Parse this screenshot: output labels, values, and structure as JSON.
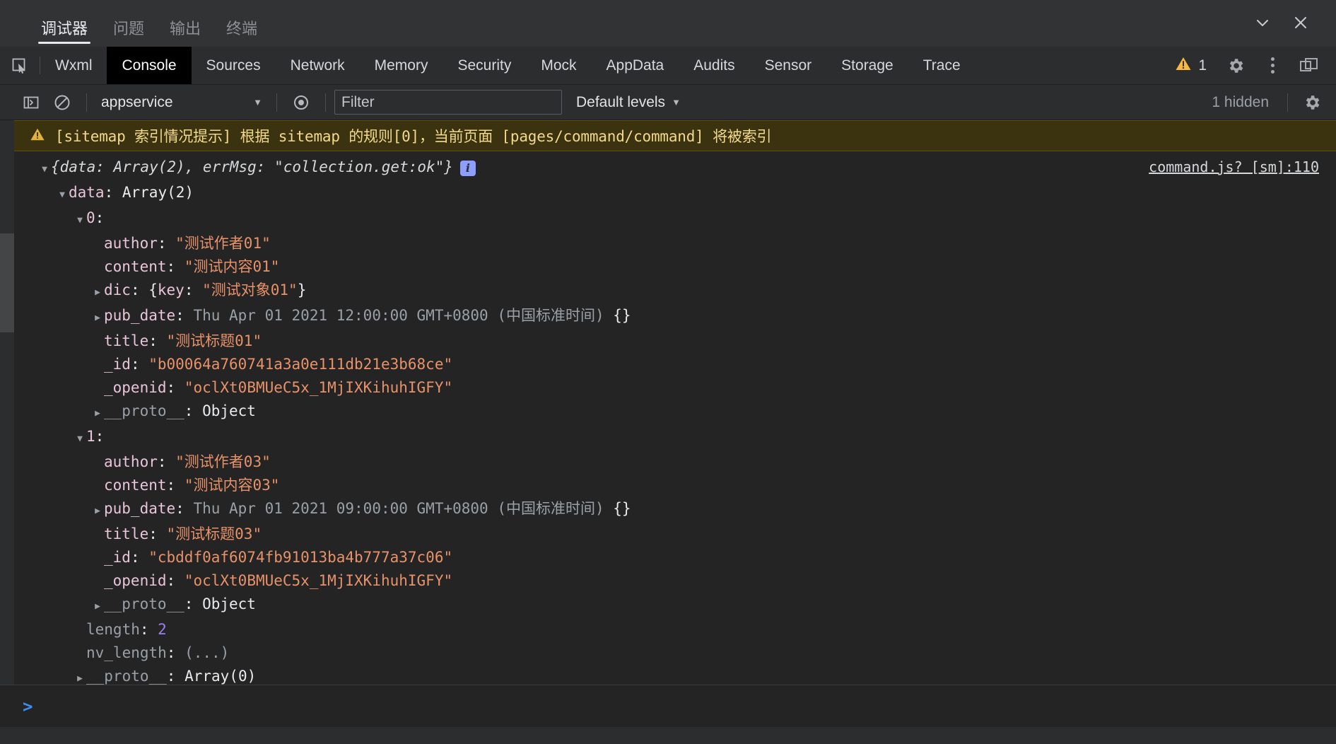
{
  "window": {
    "tabs": [
      {
        "label": "调试器",
        "active": true
      },
      {
        "label": "问题",
        "active": false
      },
      {
        "label": "输出",
        "active": false
      },
      {
        "label": "终端",
        "active": false
      }
    ],
    "minimize_icon": "chevron-down-icon",
    "close_icon": "close-icon"
  },
  "devtools": {
    "inspect_icon": "inspect-element-icon",
    "tabs": [
      {
        "label": "Wxml",
        "active": false
      },
      {
        "label": "Console",
        "active": true
      },
      {
        "label": "Sources",
        "active": false
      },
      {
        "label": "Network",
        "active": false
      },
      {
        "label": "Memory",
        "active": false
      },
      {
        "label": "Security",
        "active": false
      },
      {
        "label": "Mock",
        "active": false
      },
      {
        "label": "AppData",
        "active": false
      },
      {
        "label": "Audits",
        "active": false
      },
      {
        "label": "Sensor",
        "active": false
      },
      {
        "label": "Storage",
        "active": false
      },
      {
        "label": "Trace",
        "active": false
      }
    ],
    "warning_count": "1",
    "warning_icon": "warning-triangle-icon",
    "settings_icon": "gear-icon",
    "more_icon": "kebab-menu-icon",
    "dock_icon": "dock-panel-icon"
  },
  "toolbar": {
    "sidebar_toggle_icon": "console-sidebar-toggle-icon",
    "clear_icon": "clear-console-icon",
    "context": "appservice",
    "eye_icon": "live-expression-icon",
    "filter_placeholder": "Filter",
    "filter_value": "",
    "levels": "Default levels",
    "hidden_text": "1 hidden",
    "settings_icon": "console-settings-gear-icon"
  },
  "console": {
    "warning_icon": "warning-triangle-icon",
    "warning_message": "[sitemap 索引情况提示] 根据 sitemap 的规则[0]，当前页面 [pages/command/command] 将被索引",
    "source_link": "command.js? [sm]:110",
    "header": "{data: Array(2), errMsg: \"collection.get:ok\"}",
    "info_badge": "i",
    "prompt": ">",
    "tree": [
      {
        "indent": 1,
        "arrow": "down",
        "parts": [
          {
            "t": "prop",
            "v": "data"
          },
          {
            "t": "plain",
            "v": ": "
          },
          {
            "t": "plain",
            "v": "Array(2)"
          }
        ]
      },
      {
        "indent": 2,
        "arrow": "down",
        "parts": [
          {
            "t": "prop",
            "v": "0"
          },
          {
            "t": "plain",
            "v": ":"
          }
        ]
      },
      {
        "indent": 3,
        "arrow": "none",
        "parts": [
          {
            "t": "prop",
            "v": "author"
          },
          {
            "t": "plain",
            "v": ": "
          },
          {
            "t": "str",
            "v": "\"测试作者01\""
          }
        ]
      },
      {
        "indent": 3,
        "arrow": "none",
        "parts": [
          {
            "t": "prop",
            "v": "content"
          },
          {
            "t": "plain",
            "v": ": "
          },
          {
            "t": "str",
            "v": "\"测试内容01\""
          }
        ]
      },
      {
        "indent": 3,
        "arrow": "right",
        "parts": [
          {
            "t": "prop",
            "v": "dic"
          },
          {
            "t": "plain",
            "v": ": {"
          },
          {
            "t": "prop",
            "v": "key"
          },
          {
            "t": "plain",
            "v": ": "
          },
          {
            "t": "str",
            "v": "\"测试对象01\""
          },
          {
            "t": "plain",
            "v": "}"
          }
        ]
      },
      {
        "indent": 3,
        "arrow": "right",
        "parts": [
          {
            "t": "prop",
            "v": "pub_date"
          },
          {
            "t": "plain",
            "v": ": "
          },
          {
            "t": "dim",
            "v": "Thu Apr 01 2021 12:00:00 GMT+0800 (中国标准时间) "
          },
          {
            "t": "plain",
            "v": "{}"
          }
        ]
      },
      {
        "indent": 3,
        "arrow": "none",
        "parts": [
          {
            "t": "prop",
            "v": "title"
          },
          {
            "t": "plain",
            "v": ": "
          },
          {
            "t": "str",
            "v": "\"测试标题01\""
          }
        ]
      },
      {
        "indent": 3,
        "arrow": "none",
        "parts": [
          {
            "t": "prop",
            "v": "_id"
          },
          {
            "t": "plain",
            "v": ": "
          },
          {
            "t": "str",
            "v": "\"b00064a760741a3a0e111db21e3b68ce\""
          }
        ]
      },
      {
        "indent": 3,
        "arrow": "none",
        "parts": [
          {
            "t": "prop",
            "v": "_openid"
          },
          {
            "t": "plain",
            "v": ": "
          },
          {
            "t": "str",
            "v": "\"oclXt0BMUeC5x_1MjIXKihuhIGFY\""
          }
        ]
      },
      {
        "indent": 3,
        "arrow": "right",
        "parts": [
          {
            "t": "prop-dim",
            "v": "__proto__"
          },
          {
            "t": "plain",
            "v": ": "
          },
          {
            "t": "plain",
            "v": "Object"
          }
        ]
      },
      {
        "indent": 2,
        "arrow": "down",
        "parts": [
          {
            "t": "prop",
            "v": "1"
          },
          {
            "t": "plain",
            "v": ":"
          }
        ]
      },
      {
        "indent": 3,
        "arrow": "none",
        "parts": [
          {
            "t": "prop",
            "v": "author"
          },
          {
            "t": "plain",
            "v": ": "
          },
          {
            "t": "str",
            "v": "\"测试作者03\""
          }
        ]
      },
      {
        "indent": 3,
        "arrow": "none",
        "parts": [
          {
            "t": "prop",
            "v": "content"
          },
          {
            "t": "plain",
            "v": ": "
          },
          {
            "t": "str",
            "v": "\"测试内容03\""
          }
        ]
      },
      {
        "indent": 3,
        "arrow": "right",
        "parts": [
          {
            "t": "prop",
            "v": "pub_date"
          },
          {
            "t": "plain",
            "v": ": "
          },
          {
            "t": "dim",
            "v": "Thu Apr 01 2021 09:00:00 GMT+0800 (中国标准时间) "
          },
          {
            "t": "plain",
            "v": "{}"
          }
        ]
      },
      {
        "indent": 3,
        "arrow": "none",
        "parts": [
          {
            "t": "prop",
            "v": "title"
          },
          {
            "t": "plain",
            "v": ": "
          },
          {
            "t": "str",
            "v": "\"测试标题03\""
          }
        ]
      },
      {
        "indent": 3,
        "arrow": "none",
        "parts": [
          {
            "t": "prop",
            "v": "_id"
          },
          {
            "t": "plain",
            "v": ": "
          },
          {
            "t": "str",
            "v": "\"cbddf0af6074fb91013ba4b777a37c06\""
          }
        ]
      },
      {
        "indent": 3,
        "arrow": "none",
        "parts": [
          {
            "t": "prop",
            "v": "_openid"
          },
          {
            "t": "plain",
            "v": ": "
          },
          {
            "t": "str",
            "v": "\"oclXt0BMUeC5x_1MjIXKihuhIGFY\""
          }
        ]
      },
      {
        "indent": 3,
        "arrow": "right",
        "parts": [
          {
            "t": "prop-dim",
            "v": "__proto__"
          },
          {
            "t": "plain",
            "v": ": "
          },
          {
            "t": "plain",
            "v": "Object"
          }
        ]
      },
      {
        "indent": 2,
        "arrow": "none",
        "parts": [
          {
            "t": "prop-dim",
            "v": "length"
          },
          {
            "t": "plain",
            "v": ": "
          },
          {
            "t": "num",
            "v": "2"
          }
        ]
      },
      {
        "indent": 2,
        "arrow": "none",
        "parts": [
          {
            "t": "prop-dim",
            "v": "nv_length"
          },
          {
            "t": "plain",
            "v": ": "
          },
          {
            "t": "dim",
            "v": "(...)"
          }
        ]
      },
      {
        "indent": 2,
        "arrow": "right",
        "parts": [
          {
            "t": "prop-dim",
            "v": "__proto__"
          },
          {
            "t": "plain",
            "v": ": "
          },
          {
            "t": "plain",
            "v": "Array(0)"
          }
        ]
      },
      {
        "indent": 1,
        "arrow": "none",
        "parts": [
          {
            "t": "prop",
            "v": "errMsg"
          },
          {
            "t": "plain",
            "v": ": "
          },
          {
            "t": "str",
            "v": "\"collection.get:ok\""
          }
        ]
      },
      {
        "indent": 1,
        "arrow": "right",
        "parts": [
          {
            "t": "prop-dim",
            "v": "__proto__"
          },
          {
            "t": "plain",
            "v": ": "
          },
          {
            "t": "plain",
            "v": "Object"
          }
        ]
      }
    ]
  },
  "colors": {
    "accent": "#3b8eea",
    "string": "#e8926b",
    "property": "#e8c5d8",
    "number": "#9a7ff0",
    "warning_bg": "#3b3210",
    "warning_text": "#f2d98b",
    "panel_bg": "#242424",
    "toolbar_bg": "#2b2d2f"
  }
}
